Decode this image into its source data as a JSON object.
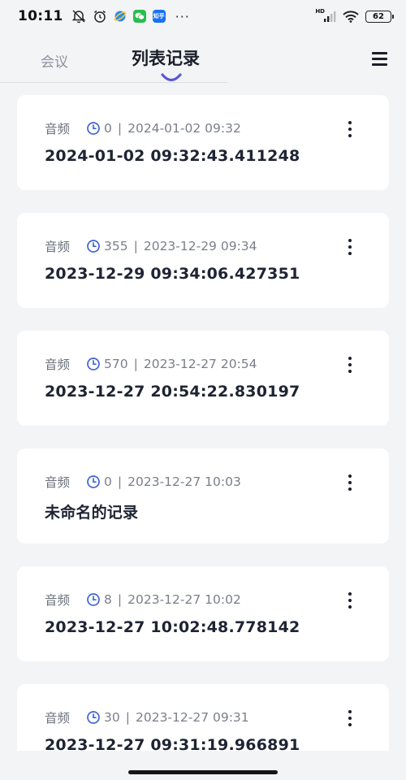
{
  "status_bar": {
    "time": "10:11",
    "left_icons": [
      "mute-bell-icon",
      "alarm-icon",
      "browser-app-icon",
      "wechat-app-icon",
      "zhihu-app-icon"
    ],
    "zhihu_label": "知乎",
    "more_indicator": "···",
    "hd_label": "HD",
    "battery_level": "62"
  },
  "header": {
    "tabs": [
      {
        "label": "会议",
        "active": false
      },
      {
        "label": "列表记录",
        "active": true
      }
    ],
    "accent_color": "#5b57d6"
  },
  "records": [
    {
      "type": "音频",
      "duration": "0",
      "datetime": "2024-01-02 09:32",
      "title": "2024-01-02 09:32:43.411248"
    },
    {
      "type": "音频",
      "duration": "355",
      "datetime": "2023-12-29 09:34",
      "title": "2023-12-29 09:34:06.427351"
    },
    {
      "type": "音频",
      "duration": "570",
      "datetime": "2023-12-27 20:54",
      "title": "2023-12-27 20:54:22.830197"
    },
    {
      "type": "音频",
      "duration": "0",
      "datetime": "2023-12-27 10:03",
      "title": "未命名的记录"
    },
    {
      "type": "音频",
      "duration": "8",
      "datetime": "2023-12-27 10:02",
      "title": "2023-12-27 10:02:48.778142"
    },
    {
      "type": "音频",
      "duration": "30",
      "datetime": "2023-12-27 09:31",
      "title": "2023-12-27 09:31:19.966891"
    }
  ],
  "colors": {
    "clock_icon": "#3f63d6",
    "background": "#f3f4f6",
    "card": "#ffffff"
  }
}
